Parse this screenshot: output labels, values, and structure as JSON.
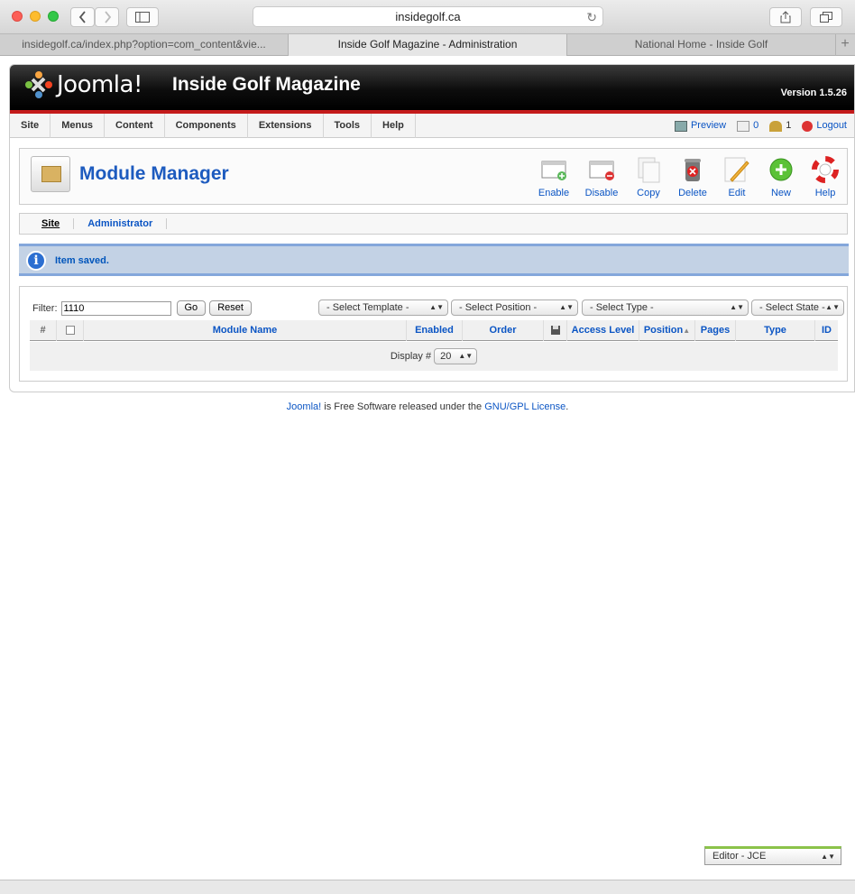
{
  "browser": {
    "url": "insidegolf.ca",
    "tabs": [
      {
        "label": "insidegolf.ca/index.php?option=com_content&vie...",
        "active": false
      },
      {
        "label": "Inside Golf Magazine - Administration",
        "active": true
      },
      {
        "label": "National Home - Inside Golf",
        "active": false
      }
    ],
    "new_tab_label": "+"
  },
  "header": {
    "logo_text": "Joomla!",
    "site_title": "Inside Golf Magazine",
    "version": "Version 1.5.26"
  },
  "menu": {
    "items": [
      "Site",
      "Menus",
      "Content",
      "Components",
      "Extensions",
      "Tools",
      "Help"
    ],
    "preview": "Preview",
    "messages_count": "0",
    "users_count": "1",
    "logout": "Logout"
  },
  "toolbar": {
    "title": "Module Manager",
    "buttons": [
      "Enable",
      "Disable",
      "Copy",
      "Delete",
      "Edit",
      "New",
      "Help"
    ]
  },
  "subnav": {
    "items": [
      "Site",
      "Administrator"
    ]
  },
  "message": {
    "text": "Item saved."
  },
  "filter": {
    "label": "Filter:",
    "value": "1110",
    "go": "Go",
    "reset": "Reset",
    "select_template": "- Select Template -",
    "select_position": "- Select Position -",
    "select_type": "- Select Type -",
    "select_state": "- Select State -"
  },
  "table": {
    "columns": [
      "#",
      "",
      "Module Name",
      "Enabled",
      "Order",
      "",
      "Access Level",
      "Position",
      "Pages",
      "Type",
      "ID"
    ],
    "display_label": "Display #",
    "display_value": "20"
  },
  "footer": {
    "joomla_link": "Joomla!",
    "text": " is Free Software released under the ",
    "license_link": "GNU/GPL License",
    "period": "."
  },
  "editor_select": {
    "value": "Editor - JCE"
  },
  "colors": {
    "accent": "#0b55c4",
    "header_red": "#c41b1b",
    "message_bg": "#c3d2e5"
  }
}
